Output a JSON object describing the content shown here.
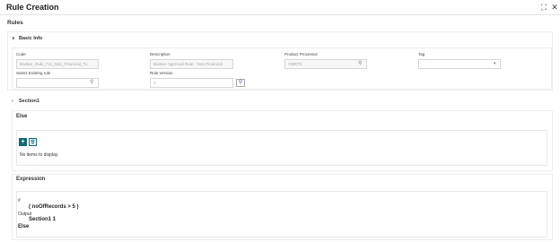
{
  "window": {
    "title": "Rule Creation"
  },
  "page": {
    "label": "Rules"
  },
  "basic_info": {
    "heading": "Basic Info",
    "code": {
      "label": "Code",
      "value": "Banker_Rule_For_Non_Financial_Tx"
    },
    "description": {
      "label": "Description",
      "value": "Banker Approval Rule - Non-Financial"
    },
    "product_processor": {
      "label": "Product Processor",
      "value": "OBRTX"
    },
    "tag": {
      "label": "Tag",
      "value": ""
    },
    "select_existing_rule": {
      "label": "Select Existing rule",
      "value": ""
    },
    "rule_version": {
      "label": "Rule Version",
      "value": "1"
    }
  },
  "section1": {
    "heading": "Section1"
  },
  "else_section": {
    "heading": "Else",
    "empty_text": "No items to display."
  },
  "expression": {
    "heading": "Expression",
    "hash": "#",
    "condition": "( noOfRecords > 5 )",
    "output_label": "Output",
    "output_value": "Section1 1",
    "else_label": "Else"
  }
}
